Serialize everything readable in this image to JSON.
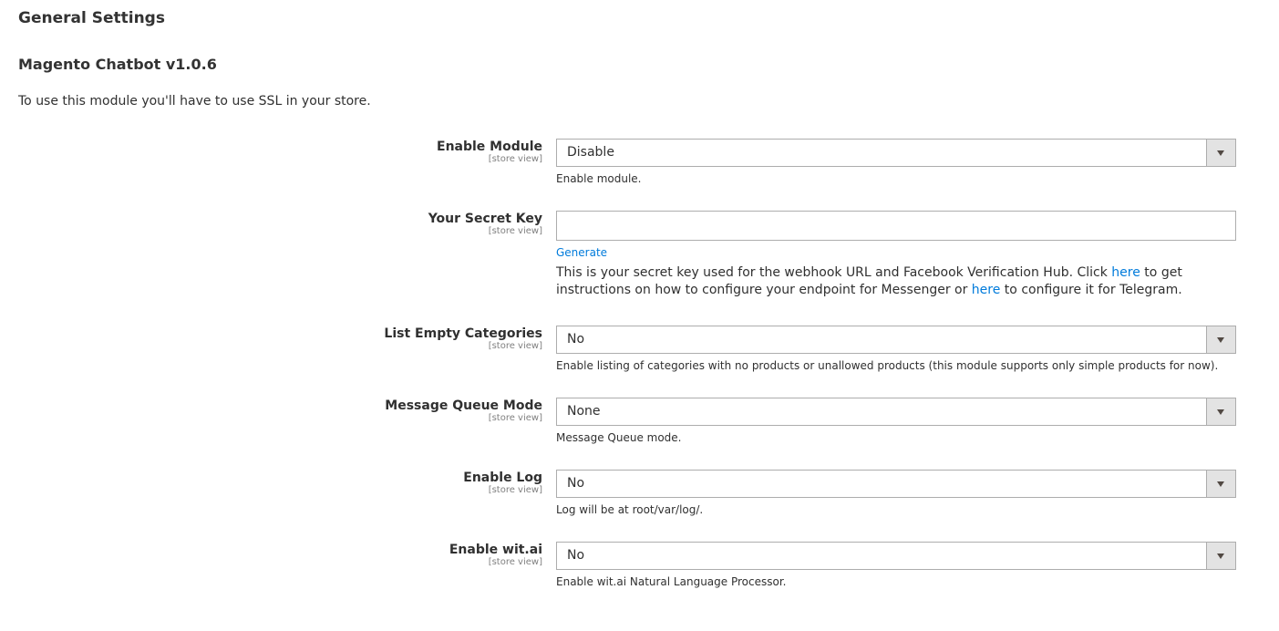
{
  "section": {
    "title": "General Settings"
  },
  "group": {
    "title": "Magento Chatbot v1.0.6",
    "intro": "To use this module you'll have to use SSL in your store."
  },
  "fields": {
    "enable_module": {
      "label": "Enable Module",
      "scope": "[store view]",
      "value": "Disable",
      "note": "Enable module."
    },
    "secret_key": {
      "label": "Your Secret Key",
      "scope": "[store view]",
      "value": "",
      "generate_label": "Generate",
      "comment_part1": "This is your secret key used for the webhook URL and Facebook Verification Hub. Click ",
      "link1": "here",
      "comment_part2": " to get instructions on how to configure your endpoint for Messenger or ",
      "link2": "here",
      "comment_part3": " to configure it for Telegram."
    },
    "list_empty_categories": {
      "label": "List Empty Categories",
      "scope": "[store view]",
      "value": "No",
      "note": "Enable listing of categories with no products or unallowed products (this module supports only simple products for now)."
    },
    "message_queue_mode": {
      "label": "Message Queue Mode",
      "scope": "[store view]",
      "value": "None",
      "note": "Message Queue mode."
    },
    "enable_log": {
      "label": "Enable Log",
      "scope": "[store view]",
      "value": "No",
      "note": "Log will be at root/var/log/."
    },
    "enable_witai": {
      "label": "Enable wit.ai",
      "scope": "[store view]",
      "value": "No",
      "note": "Enable wit.ai Natural Language Processor."
    }
  },
  "icons": {
    "select_arrow": "chevron-down-icon"
  },
  "colors": {
    "link": "#007bdb",
    "border": "#adadad",
    "select_button": "#e3e3e3"
  }
}
